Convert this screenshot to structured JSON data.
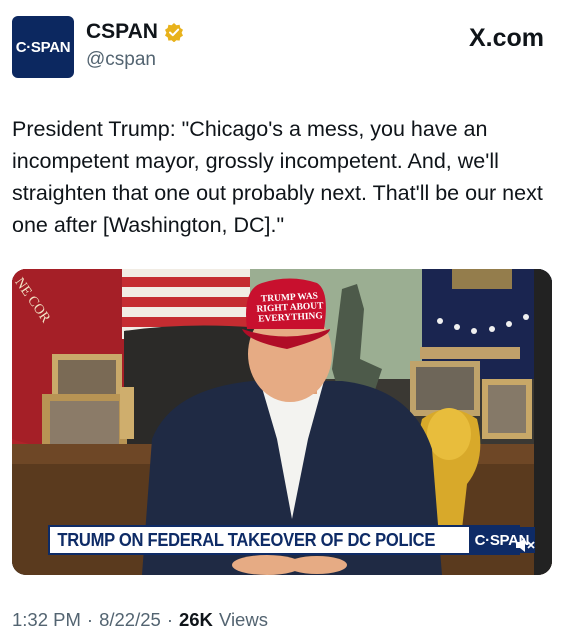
{
  "account": {
    "avatar_text": "C·SPAN",
    "display_name": "CSPAN",
    "handle": "@cspan",
    "verified": "verified-badge-icon",
    "brand_color": "#0c2860"
  },
  "site_label": "X.com",
  "tweet": {
    "text": "President Trump: \"Chicago's a mess, you have an incompetent mayor, grossly incompetent. And, we'll straighten that one out probably next. That'll be our next one after [Washington, DC].\""
  },
  "media": {
    "hat_text": "TRUMP WAS RIGHT ABOUT EVERYTHING",
    "chyron_text": "TRUMP ON FEDERAL TAKEOVER OF DC POLICE",
    "chyron_logo": "C·SPAN",
    "flag_text": "NE COR",
    "mute_icon": "speaker-muted-icon"
  },
  "meta": {
    "time": "1:32 PM",
    "separator": "·",
    "date": "8/22/25",
    "views_count": "26K",
    "views_label": "Views"
  }
}
